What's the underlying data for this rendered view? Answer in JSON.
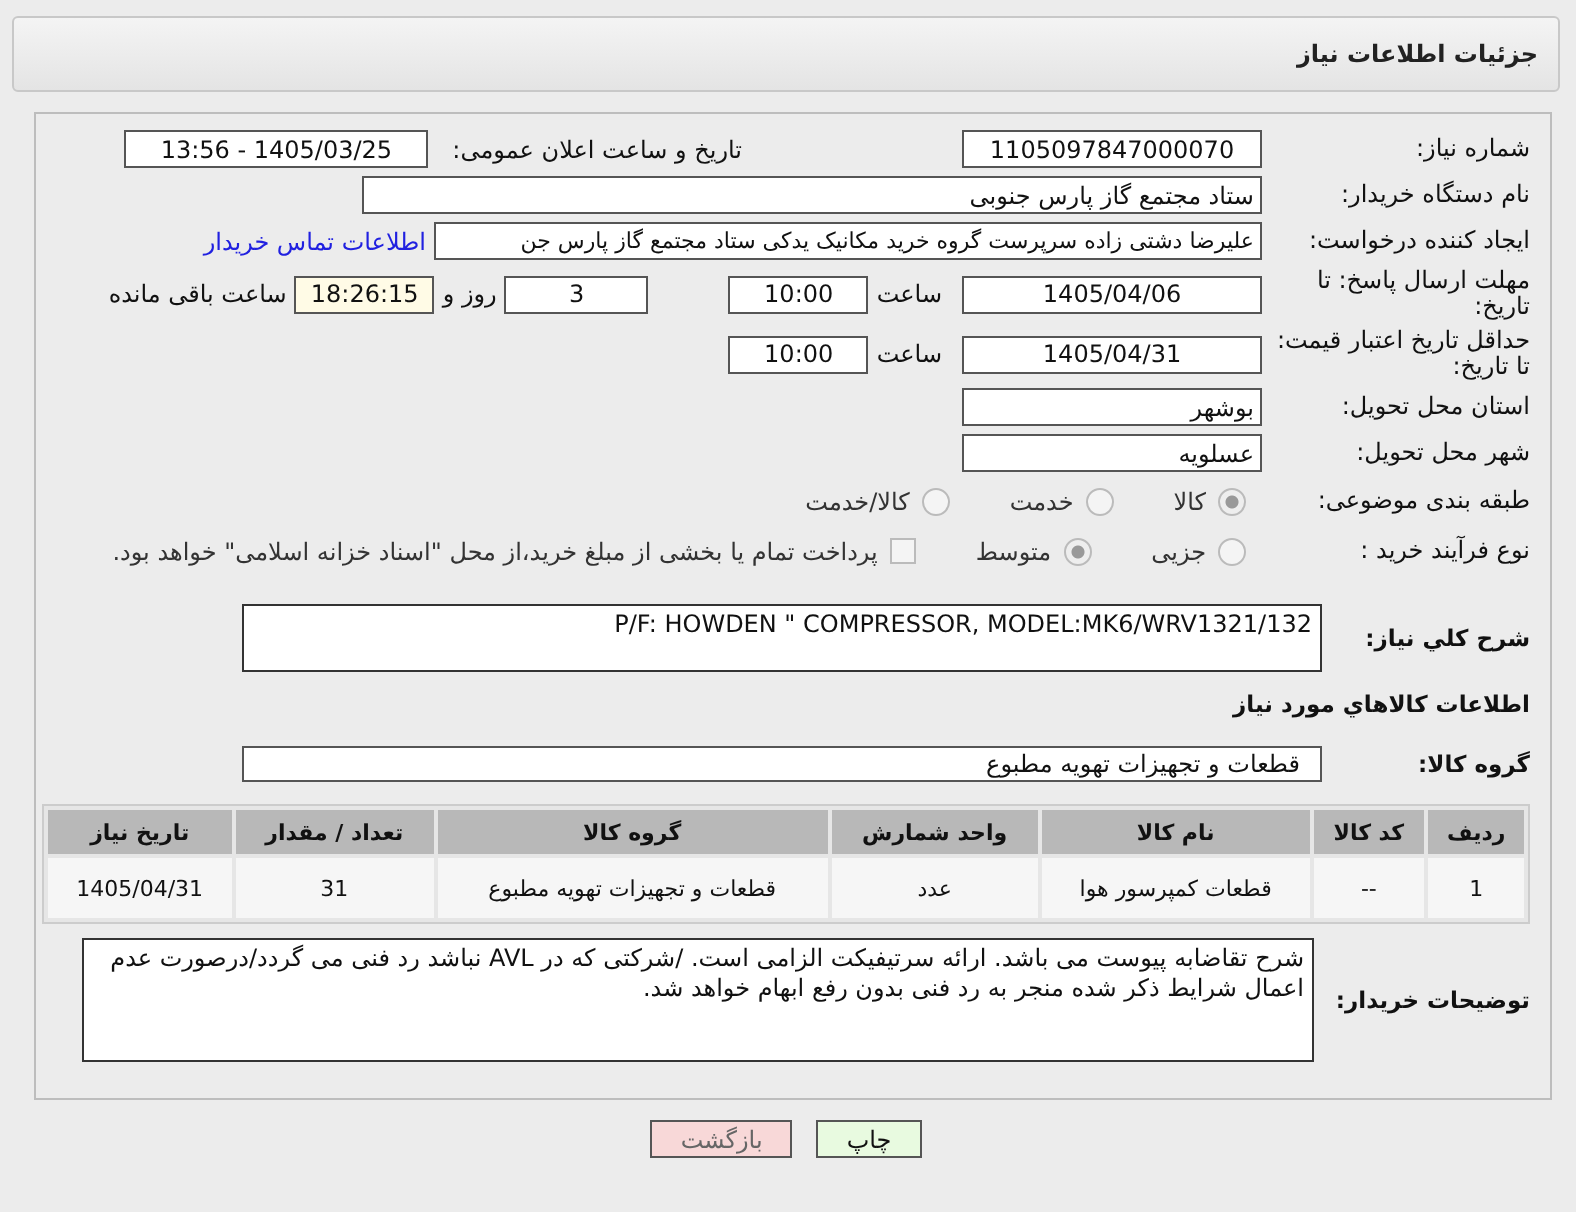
{
  "header": {
    "title": "جزئیات اطلاعات نیاز"
  },
  "need_number": {
    "label": "شماره نیاز:",
    "value": "1105097847000070"
  },
  "announce": {
    "label": "تاریخ و ساعت اعلان عمومی:",
    "value": "1405/03/25 - 13:56"
  },
  "buyer_org": {
    "label": "نام دستگاه خریدار:",
    "value": "ستاد مجتمع گاز پارس جنوبی"
  },
  "creator": {
    "label": "ایجاد کننده درخواست:",
    "value": "علیرضا دشتی زاده سرپرست گروه خرید مکانیک یدکی ستاد مجتمع گاز پارس جن",
    "link": "اطلاعات تماس خریدار"
  },
  "deadline": {
    "label": "مهلت ارسال پاسخ: تا تاریخ:",
    "date": "1405/04/06",
    "time_label": "ساعت",
    "time": "10:00",
    "days": "3",
    "days_label": "روز و",
    "remaining": "18:26:15",
    "remaining_label": "ساعت باقی مانده"
  },
  "validity": {
    "label": "حداقل تاریخ اعتبار قیمت: تا تاریخ:",
    "date": "1405/04/31",
    "time_label": "ساعت",
    "time": "10:00"
  },
  "province": {
    "label": "استان محل تحویل:",
    "value": "بوشهر"
  },
  "city": {
    "label": "شهر محل تحویل:",
    "value": "عسلویه"
  },
  "category": {
    "label": "طبقه بندی موضوعی:",
    "options": [
      {
        "label": "کالا",
        "selected": true
      },
      {
        "label": "خدمت",
        "selected": false
      },
      {
        "label": "کالا/خدمت",
        "selected": false
      }
    ]
  },
  "process": {
    "label": "نوع فرآیند خرید :",
    "options": [
      {
        "label": "جزیی",
        "selected": false
      },
      {
        "label": "متوسط",
        "selected": true
      }
    ],
    "payment": {
      "label": "پرداخت تمام یا بخشی از مبلغ خرید،از محل \"اسناد خزانه اسلامی\" خواهد بود.",
      "checked": false
    }
  },
  "description": {
    "label": "شرح کلي نیاز:",
    "value": "P/F: HOWDEN \" COMPRESSOR, MODEL:MK6/WRV1321/132"
  },
  "goods_heading": "اطلاعات کالاهاي مورد نیاز",
  "goods_group": {
    "label": "گروه کالا:",
    "value": "قطعات و تجهیزات تهویه مطبوع"
  },
  "table": {
    "columns": [
      "ردیف",
      "کد کالا",
      "نام کالا",
      "واحد شمارش",
      "گروه کالا",
      "تعداد / مقدار",
      "تاریخ نیاز"
    ],
    "rows": [
      [
        "1",
        "--",
        "قطعات کمپرسور هوا",
        "عدد",
        "قطعات و تجهیزات تهویه مطبوع",
        "31",
        "1405/04/31"
      ]
    ]
  },
  "buyer_notes": {
    "label": "توضیحات خریدار:",
    "value": "شرح تقاضابه پیوست می باشد. ارائه سرتیفیکت الزامی است. /شرکتی که در AVL نباشد رد فنی می گردد/درصورت عدم اعمال شرایط ذکر شده منجر به رد فنی بدون رفع ابهام خواهد شد."
  },
  "buttons": [
    {
      "label": "چاپ",
      "kind": "print"
    },
    {
      "label": "بازگشت",
      "kind": "back"
    }
  ]
}
